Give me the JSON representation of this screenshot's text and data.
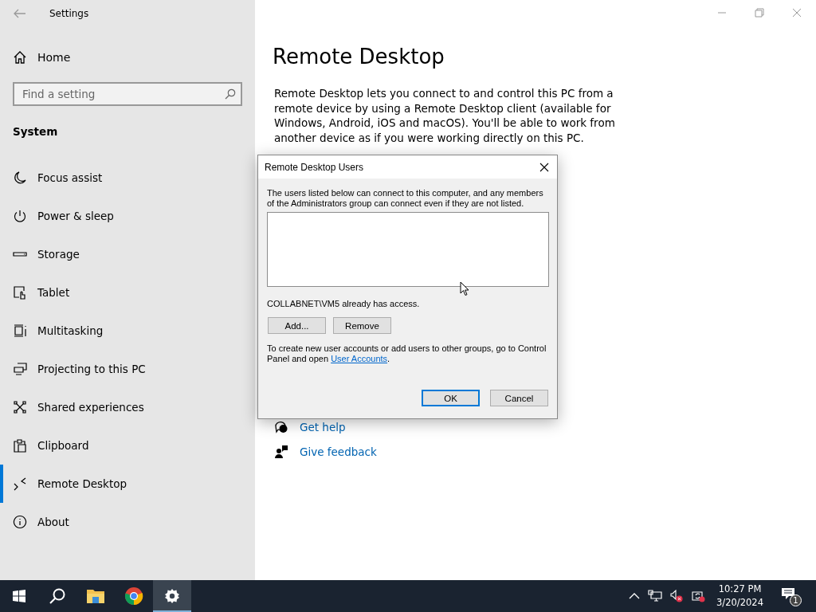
{
  "window": {
    "title": "Settings"
  },
  "sidebar": {
    "home": "Home",
    "search": {
      "placeholder": "Find a setting"
    },
    "section": "System",
    "items": [
      {
        "label": "Focus assist",
        "selected": false
      },
      {
        "label": "Power & sleep",
        "selected": false
      },
      {
        "label": "Storage",
        "selected": false
      },
      {
        "label": "Tablet",
        "selected": false
      },
      {
        "label": "Multitasking",
        "selected": false
      },
      {
        "label": "Projecting to this PC",
        "selected": false
      },
      {
        "label": "Shared experiences",
        "selected": false
      },
      {
        "label": "Clipboard",
        "selected": false
      },
      {
        "label": "Remote Desktop",
        "selected": true
      },
      {
        "label": "About",
        "selected": false
      }
    ]
  },
  "page": {
    "title": "Remote Desktop",
    "description": "Remote Desktop lets you connect to and control this PC from a remote device by using a Remote Desktop client (available for Windows, Android, iOS and macOS). You'll be able to work from another device as if you were working directly on this PC.",
    "links": [
      "Get help",
      "Give feedback"
    ]
  },
  "dialog": {
    "title": "Remote Desktop Users",
    "intro": "The users listed below can connect to this computer, and any members of the Administrators group can connect even if they are not listed.",
    "status": "COLLABNET\\VM5 already has access.",
    "buttons": [
      {
        "label": "Add..."
      },
      {
        "label": "Remove"
      }
    ],
    "note": "To create new user accounts or add users to other groups, go to Control Panel and open ",
    "note_link": "User Accounts",
    "note_end": ".",
    "footer_buttons": [
      {
        "label": "OK",
        "default": true
      },
      {
        "label": "Cancel",
        "default": false
      }
    ]
  },
  "taskbar": {
    "apps": [
      {
        "selected": false
      },
      {
        "selected": false
      },
      {
        "selected": false
      },
      {
        "selected": true
      }
    ],
    "clock": {
      "time": "10:27 PM",
      "date": "3/20/2024"
    },
    "notifications": {
      "count": "1"
    }
  }
}
